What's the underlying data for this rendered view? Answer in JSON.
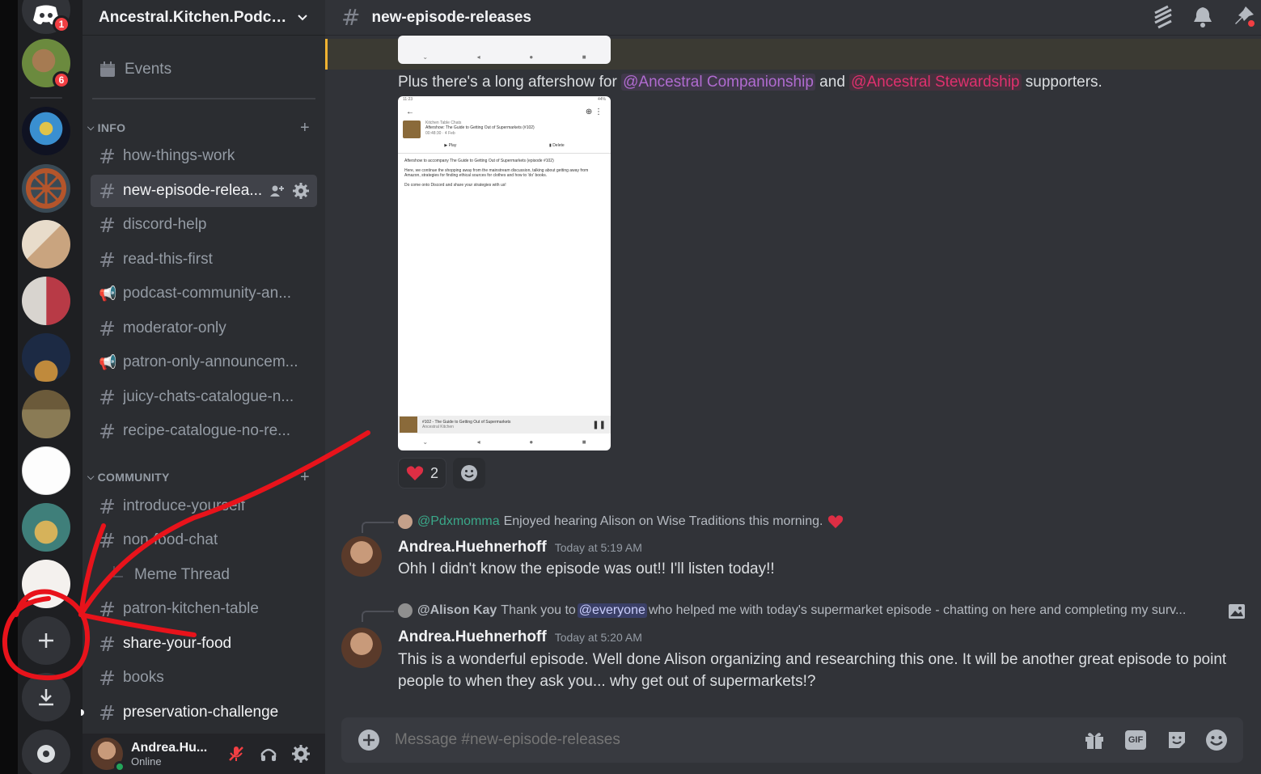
{
  "rail": {
    "home_badge": "1",
    "server_badge": "6"
  },
  "server": {
    "name": "Ancestral.Kitchen.Podca..."
  },
  "sidebar": {
    "events_label": "Events",
    "categories": {
      "info": "INFO",
      "community": "COMMUNITY"
    },
    "info_channels": [
      {
        "name": "how-things-work",
        "type": "text"
      },
      {
        "name": "new-episode-relea...",
        "type": "text"
      },
      {
        "name": "discord-help",
        "type": "text"
      },
      {
        "name": "read-this-first",
        "type": "text"
      },
      {
        "name": "podcast-community-an...",
        "type": "announcement"
      },
      {
        "name": "moderator-only",
        "type": "text"
      },
      {
        "name": "patron-only-announcem...",
        "type": "announcement"
      },
      {
        "name": "juicy-chats-catalogue-n...",
        "type": "text"
      },
      {
        "name": "recipe-catalogue-no-re...",
        "type": "text"
      }
    ],
    "community_channels": [
      {
        "name": "introduce-yourself",
        "type": "text"
      },
      {
        "name": "non-food-chat",
        "type": "text"
      },
      {
        "name": "Meme Thread",
        "type": "thread"
      },
      {
        "name": "patron-kitchen-table",
        "type": "text"
      },
      {
        "name": "share-your-food",
        "type": "text"
      },
      {
        "name": "books",
        "type": "text"
      },
      {
        "name": "preservation-challenge",
        "type": "text"
      }
    ]
  },
  "user": {
    "name": "Andrea.Hu...",
    "status": "Online"
  },
  "channel": {
    "name": "new-episode-releases"
  },
  "messages": {
    "aftershow": {
      "prefix": "Plus there's a long aftershow for ",
      "mention1": "@Ancestral Companionship",
      "middle": " and ",
      "mention2": "@Ancestral Stewardship",
      "suffix": " supporters."
    },
    "screenshot": {
      "time": "11:23",
      "status": "44%",
      "show": "Kitchen Table Chats",
      "episode": "Aftershow: The Guide to Getting Out of Supermarkets (#102)",
      "meta": "00:48:30 · 4 Feb",
      "play": "Play",
      "delete": "Delete",
      "desc1": "Aftershow to accompany The Guide to Getting Out of Supermarkets (episode #102)",
      "desc2": "Here, we continue the shopping away from the mainstream discussion, talking about getting away from Amazon, strategies for finding ethical sources for clothes and how to 'do' books.",
      "desc3": "Do come onto Discord and share your strategies with us!",
      "player_title": "#102 - The Guide to Getting Out of Supermarkets",
      "player_sub": "Ancestral Kitchen"
    },
    "reaction_count": "2",
    "msg1": {
      "reply_user": "@Pdxmomma",
      "reply_text": "Enjoyed hearing Alison on Wise Traditions this morning.",
      "author": "Andrea.Huehnerhoff",
      "time": "Today at 5:19 AM",
      "text": "Ohh I didn't know the episode was out!! I'll listen today!!"
    },
    "msg2": {
      "reply_user": "@Alison Kay",
      "reply_pre": "Thank you to ",
      "reply_mention": "@everyone",
      "reply_text": " who helped me with today's supermarket episode - chatting on here and completing my surv...",
      "author": "Andrea.Huehnerhoff",
      "time": "Today at 5:20 AM",
      "text_line1": "This is a wonderful episode. Well done Alison organizing and researching this one. It will be another great episode to point",
      "text_line2": "people to when they ask you... why get out of supermarkets!?"
    }
  },
  "composer": {
    "placeholder": "Message #new-episode-releases",
    "gif_label": "GIF"
  },
  "colors": {
    "accent": "#5865f2",
    "danger": "#f23f43",
    "companionship": "#9b59b6",
    "stewardship": "#e91e63",
    "annotation": "#e8131b"
  }
}
